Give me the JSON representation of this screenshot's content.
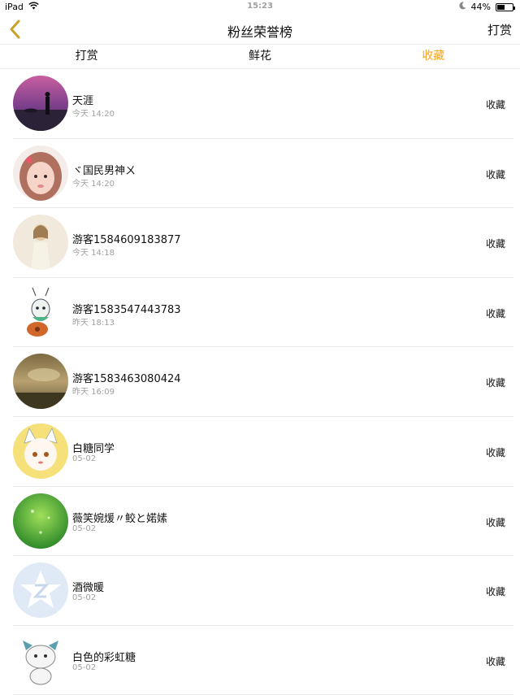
{
  "status_bar": {
    "device": "iPad",
    "time": "15:23",
    "battery": "44%",
    "battery_level": 0.44,
    "icons": [
      "wifi-icon",
      "moon-icon",
      "battery-icon"
    ]
  },
  "nav": {
    "title": "粉丝荣誉榜",
    "right_action": "打赏",
    "back_icon": "chevron-left-icon",
    "accent_color": "#c9a227"
  },
  "tabs": [
    {
      "label": "打赏",
      "active": false
    },
    {
      "label": "鲜花",
      "active": false
    },
    {
      "label": "收藏",
      "active": true
    }
  ],
  "colors": {
    "active_tab": "#f5a623",
    "timestamp": "#a0a0a0",
    "divider": "#e8e8e8"
  },
  "entries": [
    {
      "name": "天涯",
      "time": "今天 14:20",
      "action": "收藏"
    },
    {
      "name": "ヾ国民男神ㄨ",
      "time": "今天 14:20",
      "action": "收藏"
    },
    {
      "name": "游客1584609183877",
      "time": "今天 14:18",
      "action": "收藏"
    },
    {
      "name": "游客1583547443783",
      "time": "昨天 18:13",
      "action": "收藏"
    },
    {
      "name": "游客1583463080424",
      "time": "昨天 16:09",
      "action": "收藏"
    },
    {
      "name": "白糖同学",
      "time": "05-02",
      "action": "收藏"
    },
    {
      "name": "薇笑婉煖〃鲛と婼嫊",
      "time": "05-02",
      "action": "收藏"
    },
    {
      "name": "酒微暖",
      "time": "05-02",
      "action": "收藏"
    },
    {
      "name": "白色的彩虹糖",
      "time": "05-02",
      "action": "收藏"
    }
  ]
}
